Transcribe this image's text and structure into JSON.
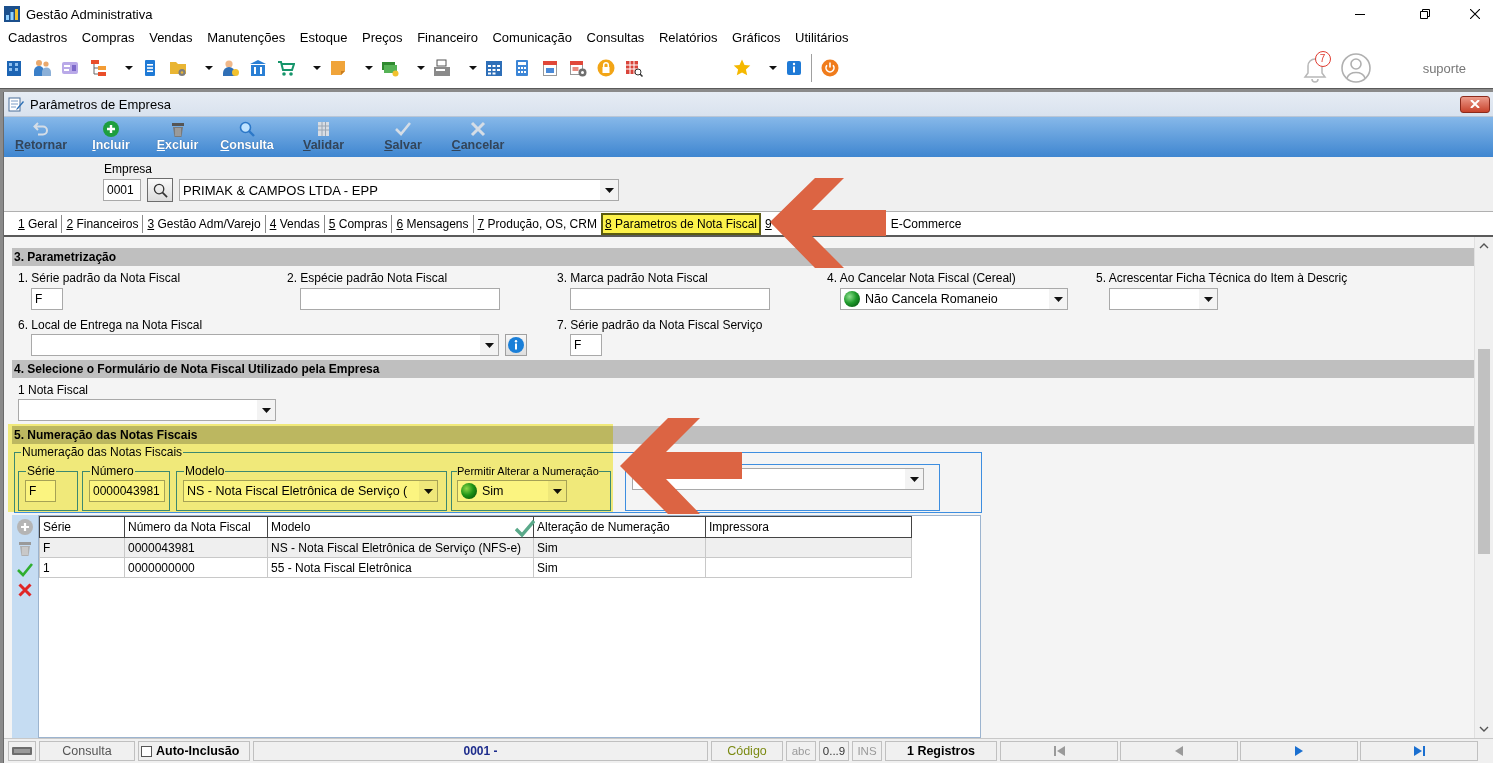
{
  "window": {
    "title": "Gestão Administrativa"
  },
  "menu": [
    "Cadastros",
    "Compras",
    "Vendas",
    "Manutenções",
    "Estoque",
    "Preços",
    "Financeiro",
    "Comunicação",
    "Consultas",
    "Relatórios",
    "Gráficos",
    "Utilitários"
  ],
  "user": {
    "notifications": "7",
    "name": "suporte"
  },
  "child_window": {
    "title": "Parâmetros de Empresa"
  },
  "actions": [
    {
      "label": "Retornar",
      "disabled": true,
      "accel": true
    },
    {
      "label": "Incluir",
      "disabled": false,
      "accel": true
    },
    {
      "label": "Excluir",
      "disabled": false,
      "accel": true
    },
    {
      "label": "Consulta",
      "disabled": false,
      "accel": true
    },
    {
      "label": "Validar",
      "disabled": true,
      "accel": true
    },
    {
      "label": "Salvar",
      "disabled": true,
      "accel": true
    },
    {
      "label": "Cancelar",
      "disabled": true,
      "accel": true
    }
  ],
  "empresa": {
    "label": "Empresa",
    "code": "0001",
    "name": "PRIMAK & CAMPOS LTDA - EPP"
  },
  "tabs": [
    {
      "number": "1",
      "label": "Geral",
      "selected": false
    },
    {
      "number": "2",
      "label": "Financeiros",
      "selected": false
    },
    {
      "number": "3",
      "label": "Gestão Adm/Varejo",
      "selected": false
    },
    {
      "number": "4",
      "label": "Vendas",
      "selected": false
    },
    {
      "number": "5",
      "label": "Compras",
      "selected": false
    },
    {
      "number": "6",
      "label": "Mensagens",
      "selected": false
    },
    {
      "number": "7",
      "label": "Produção, OS, CRM",
      "selected": false
    },
    {
      "number": "8",
      "label": "Parametros de Nota Fiscal",
      "selected": true
    },
    {
      "number": "9",
      "selected": false
    },
    {
      "label": "E-Commerce",
      "selected": false
    }
  ],
  "parametrizacao": {
    "title": "3. Parametrização",
    "fields": [
      {
        "label": "1. Série padrão da Nota Fiscal",
        "kind": "text",
        "value": "F"
      },
      {
        "label": "2. Espécie padrão Nota Fiscal",
        "kind": "text"
      },
      {
        "label": "3. Marca padrão Nota Fiscal",
        "kind": "text"
      },
      {
        "label": "4. Ao Cancelar Nota Fiscal (Cereal)",
        "kind": "icon_select",
        "value": "Não Cancela Romaneio"
      },
      {
        "label": "5. Acrescentar Ficha Técnica do Item à Descriç",
        "kind": "select"
      },
      {
        "label": "6. Local de Entrega na Nota Fiscal",
        "kind": "select_info"
      },
      {
        "label": "7. Série padrão da Nota Fiscal Serviço",
        "kind": "text",
        "value": "F"
      }
    ]
  },
  "formulario": {
    "title": "4. Selecione o Formulário de Nota Fiscal Utilizado pela Empresa",
    "fields": [
      {
        "label": "1 Nota Fiscal",
        "kind": "select"
      }
    ]
  },
  "numeracao": {
    "title": "5. Numeração das Notas Fiscais",
    "group": "Numeração das Notas Fiscais",
    "fields": [
      {
        "label": "Série",
        "kind": "text",
        "value": "F"
      },
      {
        "label": "Número",
        "kind": "text",
        "value": "0000043981"
      },
      {
        "label": "Modelo",
        "kind": "select",
        "value": "NS - Nota Fiscal Eletrônica de Serviço ("
      },
      {
        "label": "Permitir Alterar a Numeração",
        "kind": "icon_select",
        "value": "Sim"
      },
      {
        "kind": "select"
      }
    ]
  },
  "grid": {
    "columns": [
      "Série",
      "Número da Nota Fiscal",
      "Modelo",
      "Alteração de Numeração",
      "Impressora"
    ],
    "rows": [
      {
        "cells": [
          "F",
          "0000043981",
          "NS - Nota Fiscal Eletrônica de Serviço (NFS-e)",
          "Sim"
        ],
        "selected": true
      },
      {
        "cells": [
          "1",
          "0000000000",
          "55 - Nota Fiscal Eletrônica",
          "Sim"
        ],
        "selected": false
      }
    ]
  },
  "status_bar": {
    "mode": "Consulta",
    "auto_inclusion": {
      "label": "Auto-Inclusão",
      "checked": false
    },
    "record": "0001 -",
    "field": "Código",
    "indicators": [
      {
        "label": "abc",
        "active": false
      },
      {
        "label": "0...9",
        "active": true
      },
      {
        "label": "INS",
        "active": false
      }
    ],
    "count": "1 Registros",
    "navigation": [
      {
        "kind": "first",
        "disabled": true
      },
      {
        "kind": "prev",
        "disabled": true
      },
      {
        "kind": "next",
        "disabled": false
      },
      {
        "kind": "last",
        "disabled": false
      }
    ]
  }
}
